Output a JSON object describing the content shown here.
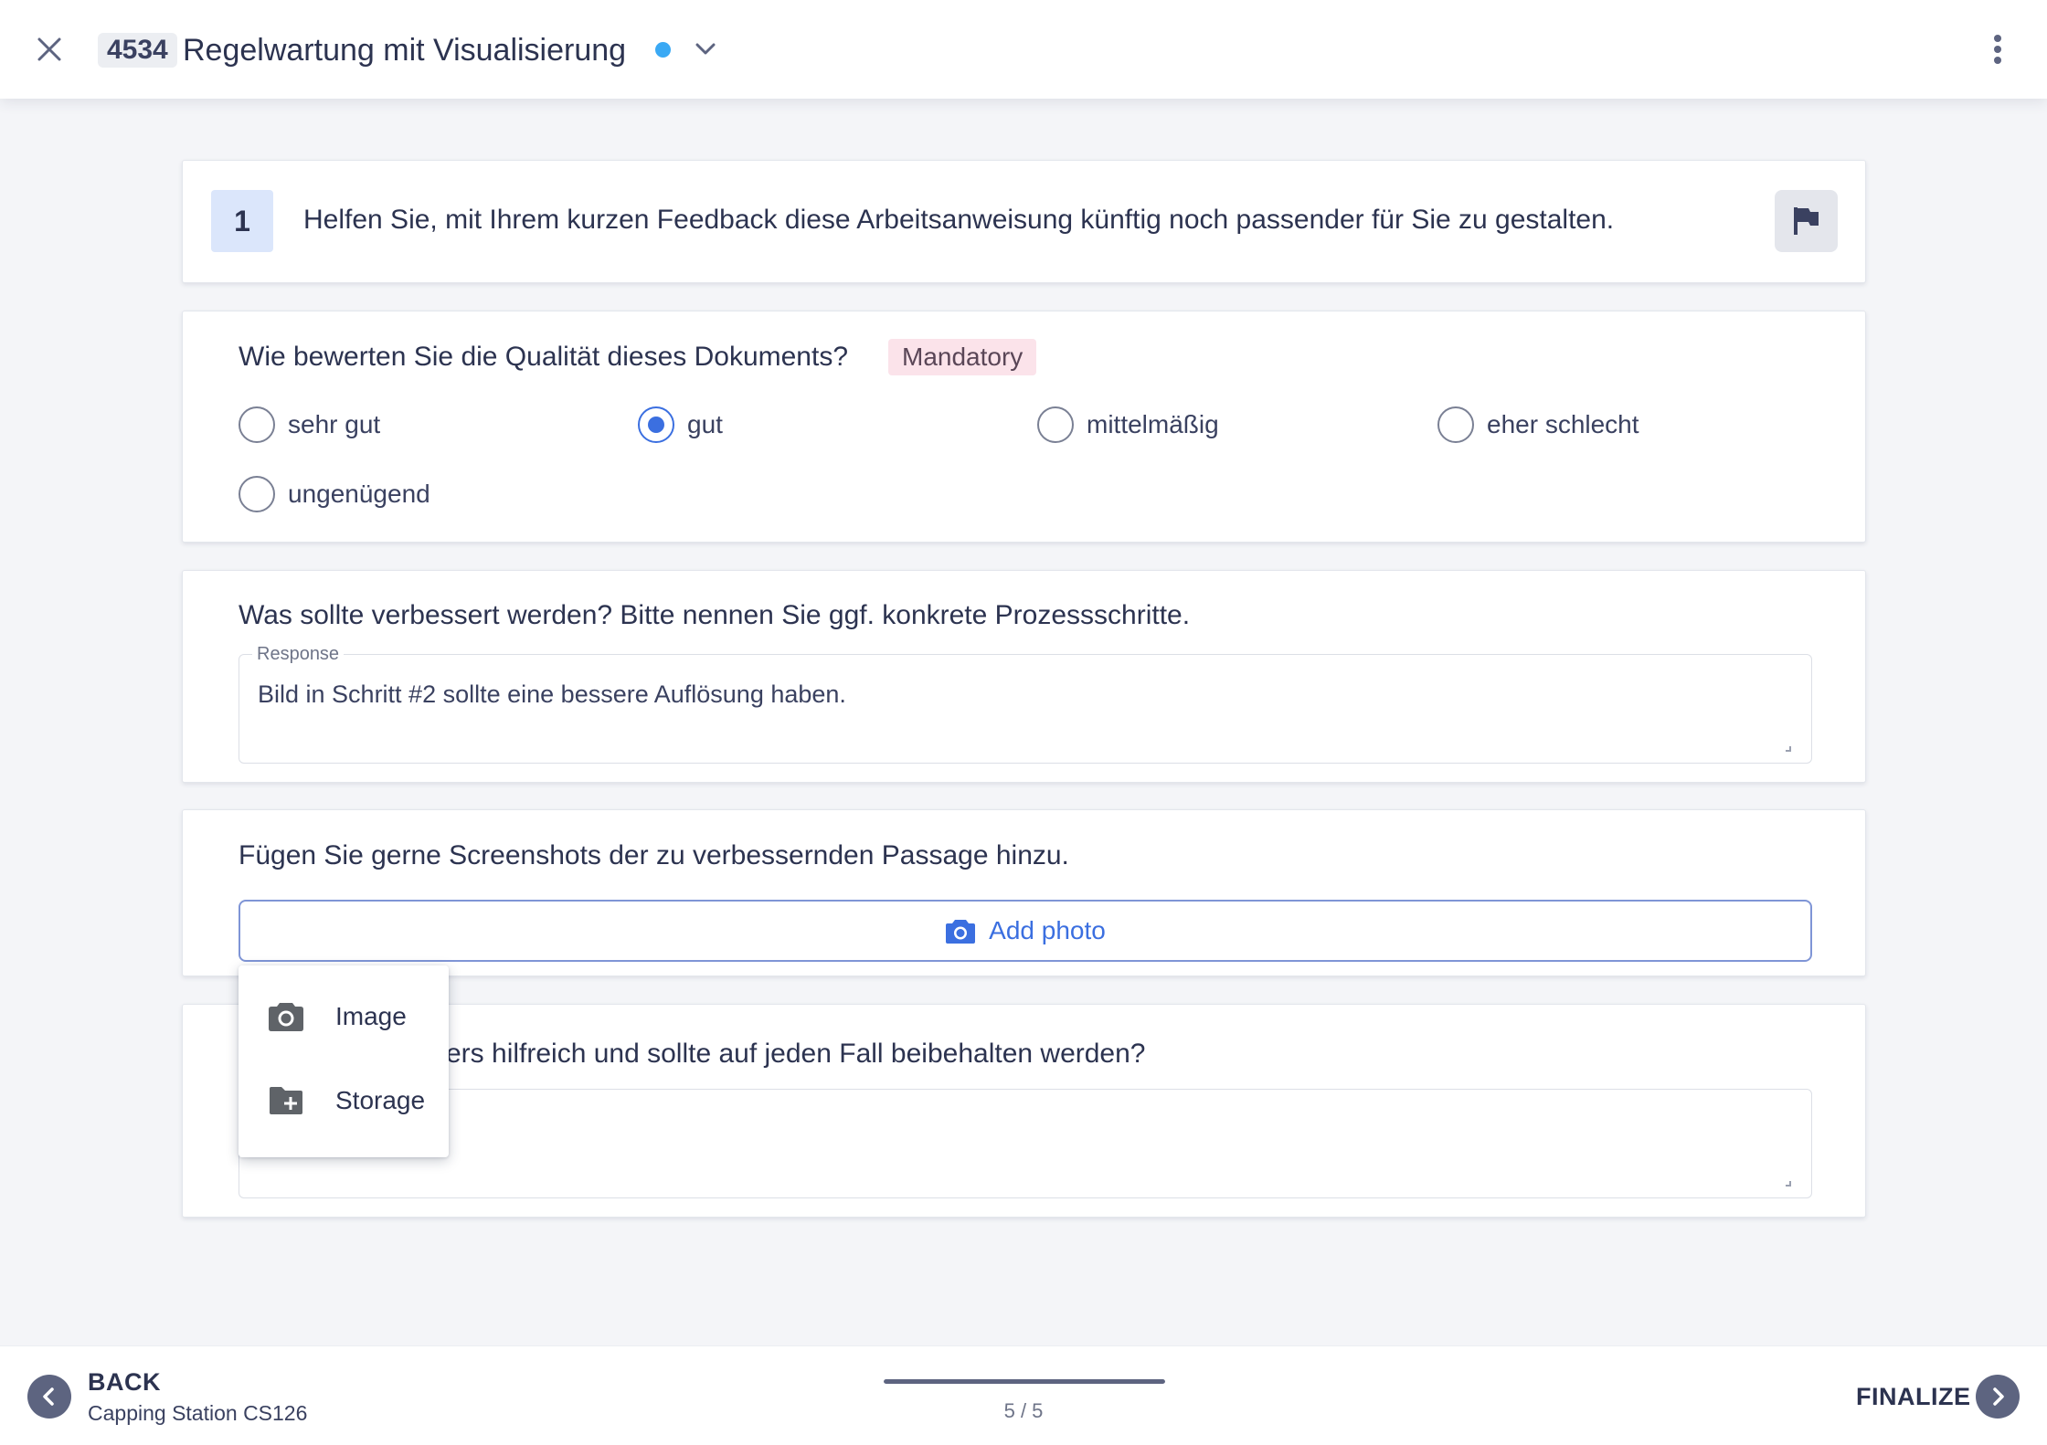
{
  "header": {
    "doc_id": "4534",
    "title": "Regelwartung mit Visualisierung",
    "status_color": "#3aa9f4"
  },
  "step": {
    "number": "1",
    "text": "Helfen Sie, mit Ihrem kurzen Feedback diese Arbeitsanweisung künftig noch passender für Sie zu gestalten."
  },
  "quality_question": {
    "title": "Wie bewerten Sie die Qualität dieses Dokuments?",
    "badge": "Mandatory",
    "options": [
      "sehr gut",
      "gut",
      "mittelmäßig",
      "eher schlecht",
      "ungenügend"
    ],
    "selected": "gut"
  },
  "improve_question": {
    "title": "Was sollte verbessert werden? Bitte nennen Sie ggf. konkrete Prozessschritte.",
    "field_label": "Response",
    "value": "Bild in Schritt #2 sollte eine bessere Auflösung haben."
  },
  "screenshot_question": {
    "title": "Fügen Sie gerne Screenshots der zu verbessernden Passage hinzu.",
    "button_label": "Add photo"
  },
  "keep_question": {
    "title_visible": "ers hilfreich und sollte auf jeden Fall beibehalten werden?",
    "value": ""
  },
  "photo_menu": {
    "items": [
      "Image",
      "Storage"
    ]
  },
  "footer": {
    "back_label": "BACK",
    "back_sub": "Capping Station CS126",
    "finalize_label": "FINALIZE",
    "progress_text": "5 / 5",
    "progress_fraction": 1.0
  },
  "colors": {
    "accent": "#3b6fe0",
    "mandatory_bg": "#fbe3ea",
    "step_badge_bg": "#dbe6fb"
  }
}
